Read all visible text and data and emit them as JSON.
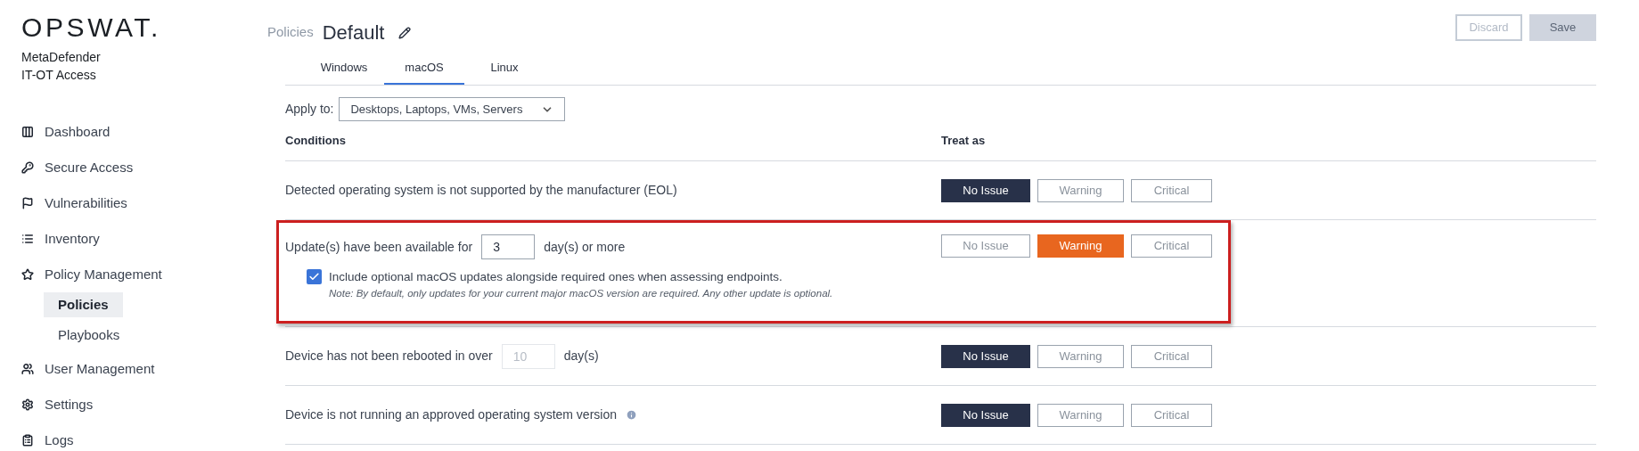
{
  "sidebar": {
    "brand": "OPSWAT.",
    "product": [
      "MetaDefender",
      "IT-OT Access"
    ],
    "items": [
      {
        "label": "Dashboard",
        "selected": false
      },
      {
        "label": "Secure Access",
        "selected": false
      },
      {
        "label": "Vulnerabilities",
        "selected": false
      },
      {
        "label": "Inventory",
        "selected": false
      },
      {
        "label": "Policy Management",
        "selected": false,
        "children": [
          {
            "label": "Policies",
            "selected": true
          },
          {
            "label": "Playbooks",
            "selected": false
          }
        ]
      },
      {
        "label": "User Management",
        "selected": false
      },
      {
        "label": "Settings",
        "selected": false
      },
      {
        "label": "Logs",
        "selected": false
      }
    ]
  },
  "header": {
    "breadcrumb": "Policies",
    "title": "Default",
    "buttons": [
      {
        "label": "Discard",
        "kind": "outline",
        "disabled": true
      },
      {
        "label": "Save",
        "kind": "filled",
        "disabled": true
      }
    ]
  },
  "tabs": [
    {
      "label": "Windows",
      "selected": false
    },
    {
      "label": "macOS",
      "selected": true
    },
    {
      "label": "Linux",
      "selected": false
    }
  ],
  "apply_to": {
    "label": "Apply to:",
    "value": "Desktops, Laptops, VMs, Servers"
  },
  "table": {
    "columns": [
      "Conditions",
      "Treat as"
    ],
    "rows": [
      {
        "kind": "text",
        "text": "Detected operating system is not supported by the manufacturer (EOL)",
        "highlighted": false,
        "options": [
          {
            "label": "No Issue",
            "selected": true
          },
          {
            "label": "Warning",
            "selected": false
          },
          {
            "label": "Critical",
            "selected": false
          }
        ]
      },
      {
        "kind": "days",
        "text": "Update(s) have been available for",
        "value": "3",
        "disabled": false,
        "suffix": "day(s) or more",
        "highlighted": true,
        "checkbox": {
          "label": "Include optional macOS updates alongside required ones when assessing endpoints.",
          "checked": true,
          "note": "Note: By default, only updates for your current major macOS version are required. Any other update is optional."
        },
        "options": [
          {
            "label": "No Issue",
            "selected": false
          },
          {
            "label": "Warning",
            "selected": true
          },
          {
            "label": "Critical",
            "selected": false
          }
        ]
      },
      {
        "kind": "days",
        "text": "Device has not been rebooted in over",
        "value": "10",
        "disabled": true,
        "suffix": "day(s)",
        "highlighted": false,
        "options": [
          {
            "label": "No Issue",
            "selected": true
          },
          {
            "label": "Warning",
            "selected": false
          },
          {
            "label": "Critical",
            "selected": false
          }
        ]
      },
      {
        "kind": "info",
        "text": "Device is not running an approved operating system version",
        "highlighted": false,
        "options": [
          {
            "label": "No Issue",
            "selected": true
          },
          {
            "label": "Warning",
            "selected": false
          },
          {
            "label": "Critical",
            "selected": false
          }
        ]
      }
    ]
  }
}
